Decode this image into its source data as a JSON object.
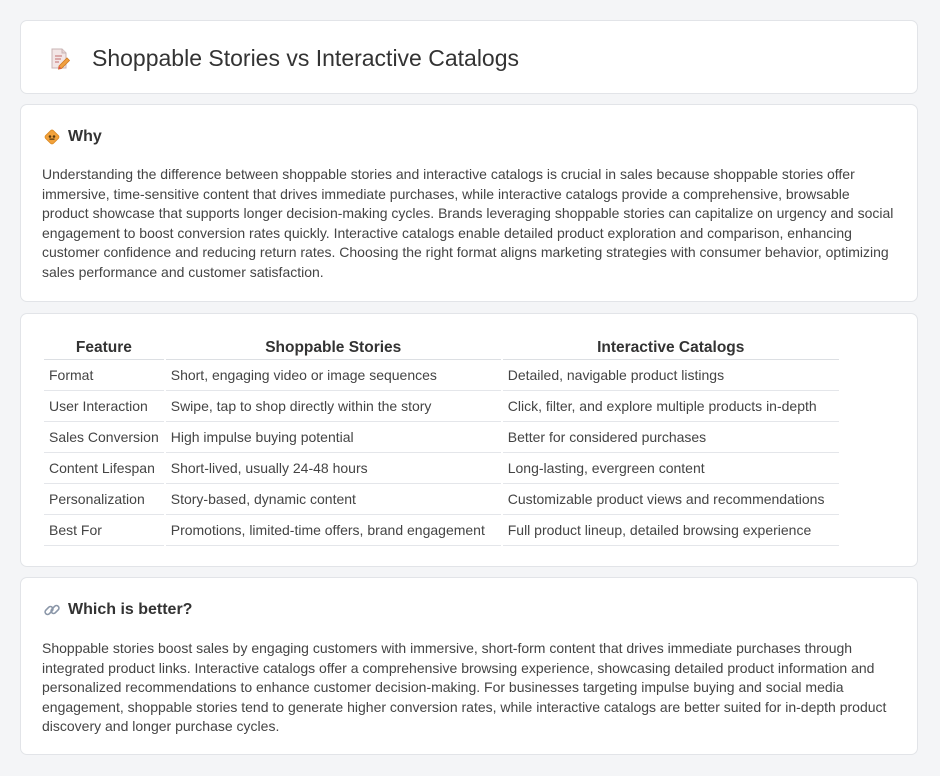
{
  "header": {
    "title": "Shoppable Stories vs Interactive Catalogs",
    "icon": "document-pencil-icon"
  },
  "why": {
    "title": "Why",
    "icon": "diamond-sign-icon",
    "text": "Understanding the difference between shoppable stories and interactive catalogs is crucial in sales because shoppable stories offer immersive, time-sensitive content that drives immediate purchases, while interactive catalogs provide a comprehensive, browsable product showcase that supports longer decision-making cycles. Brands leveraging shoppable stories can capitalize on urgency and social engagement to boost conversion rates quickly. Interactive catalogs enable detailed product exploration and comparison, enhancing customer confidence and reducing return rates. Choosing the right format aligns marketing strategies with consumer behavior, optimizing sales performance and customer satisfaction."
  },
  "table": {
    "headers": [
      "Feature",
      "Shoppable Stories",
      "Interactive Catalogs"
    ],
    "rows": [
      [
        "Format",
        "Short, engaging video or image sequences",
        "Detailed, navigable product listings"
      ],
      [
        "User Interaction",
        "Swipe, tap to shop directly within the story",
        "Click, filter, and explore multiple products in-depth"
      ],
      [
        "Sales Conversion",
        "High impulse buying potential",
        "Better for considered purchases"
      ],
      [
        "Content Lifespan",
        "Short-lived, usually 24-48 hours",
        "Long-lasting, evergreen content"
      ],
      [
        "Personalization",
        "Story-based, dynamic content",
        "Customizable product views and recommendations"
      ],
      [
        "Best For",
        "Promotions, limited-time offers, brand engagement",
        "Full product lineup, detailed browsing experience"
      ]
    ]
  },
  "better": {
    "title": "Which is better?",
    "icon": "link-icon",
    "text": "Shoppable stories boost sales by engaging customers with immersive, short-form content that drives immediate purchases through integrated product links. Interactive catalogs offer a comprehensive browsing experience, showcasing detailed product information and personalized recommendations to enhance customer decision-making. For businesses targeting impulse buying and social media engagement, shoppable stories tend to generate higher conversion rates, while interactive catalogs are better suited for in-depth product discovery and longer purchase cycles."
  },
  "colors": {
    "background": "#f4f5f7",
    "card": "#ffffff",
    "border": "#e2e4e8",
    "accent_orange": "#f2a23c"
  }
}
